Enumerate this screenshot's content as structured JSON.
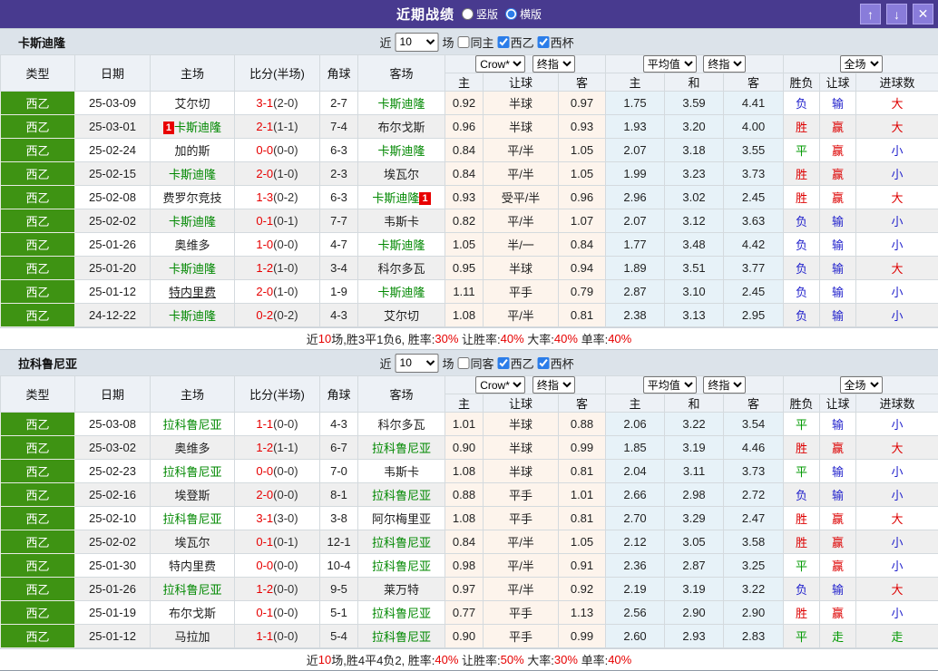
{
  "titlebar": {
    "title": "近期战绩",
    "radios": [
      {
        "label": "竖版",
        "checked": false
      },
      {
        "label": "横版",
        "checked": true
      }
    ],
    "buttons": {
      "up": "↑",
      "down": "↓",
      "close": "✕"
    }
  },
  "colors": {
    "titlebar_purple": "#483a8f",
    "league_green": "#3e9313",
    "win_red": "#dd0000",
    "lose_blue": "#2222cc",
    "draw_green": "#009900",
    "team_green": "#008800",
    "score_red": "#e60000",
    "handicap_col_bg": "#fdf4ec",
    "euro_col_bg": "#e7f2f8"
  },
  "table_headers": {
    "left": [
      "类型",
      "日期",
      "主场",
      "比分(半场)",
      "角球",
      "客场"
    ],
    "groups": [
      {
        "selects": [
          "Crow*",
          "终指"
        ],
        "cols": [
          "主",
          "让球",
          "客"
        ]
      },
      {
        "selects": [
          "平均值",
          "终指"
        ],
        "cols": [
          "主",
          "和",
          "客"
        ]
      },
      {
        "selects": [
          "全场"
        ],
        "cols": [
          "胜负",
          "让球",
          "进球数"
        ]
      }
    ]
  },
  "sections": [
    {
      "team": "卡斯迪隆",
      "filter": {
        "recent_label": "近",
        "count": "10",
        "matches_label": "场",
        "same_label": "同主",
        "same_checked": false,
        "league_label": "西乙",
        "league_checked": true,
        "cup_label": "西杯",
        "cup_checked": true
      },
      "rows": [
        {
          "lg": "西乙",
          "date": "25-03-09",
          "home": {
            "n": "艾尔切"
          },
          "ft": "3-1",
          "ht": "(2-0)",
          "cn": "2-7",
          "away": {
            "n": "卡斯迪隆",
            "g": true
          },
          "ah": [
            "0.92",
            "半球",
            "0.97"
          ],
          "eu": [
            "1.75",
            "3.59",
            "4.41"
          ],
          "res": [
            [
              "负",
              "blue"
            ],
            [
              "输",
              "blue"
            ],
            [
              "大",
              "red"
            ]
          ]
        },
        {
          "lg": "西乙",
          "date": "25-03-01",
          "home": {
            "n": "卡斯迪隆",
            "g": true,
            "b": "1",
            "bp": "l"
          },
          "ft": "2-1",
          "ht": "(1-1)",
          "cn": "7-4",
          "away": {
            "n": "布尔戈斯"
          },
          "ah": [
            "0.96",
            "半球",
            "0.93"
          ],
          "eu": [
            "1.93",
            "3.20",
            "4.00"
          ],
          "res": [
            [
              "胜",
              "red"
            ],
            [
              "赢",
              "red"
            ],
            [
              "大",
              "red"
            ]
          ]
        },
        {
          "lg": "西乙",
          "date": "25-02-24",
          "home": {
            "n": "加的斯"
          },
          "ft": "0-0",
          "ht": "(0-0)",
          "cn": "6-3",
          "away": {
            "n": "卡斯迪隆",
            "g": true
          },
          "ah": [
            "0.84",
            "平/半",
            "1.05"
          ],
          "eu": [
            "2.07",
            "3.18",
            "3.55"
          ],
          "res": [
            [
              "平",
              "green"
            ],
            [
              "赢",
              "red"
            ],
            [
              "小",
              "blue"
            ]
          ]
        },
        {
          "lg": "西乙",
          "date": "25-02-15",
          "home": {
            "n": "卡斯迪隆",
            "g": true
          },
          "ft": "2-0",
          "ht": "(1-0)",
          "cn": "2-3",
          "away": {
            "n": "埃瓦尔"
          },
          "ah": [
            "0.84",
            "平/半",
            "1.05"
          ],
          "eu": [
            "1.99",
            "3.23",
            "3.73"
          ],
          "res": [
            [
              "胜",
              "red"
            ],
            [
              "赢",
              "red"
            ],
            [
              "小",
              "blue"
            ]
          ]
        },
        {
          "lg": "西乙",
          "date": "25-02-08",
          "home": {
            "n": "费罗尔竞技"
          },
          "ft": "1-3",
          "ht": "(0-2)",
          "cn": "6-3",
          "away": {
            "n": "卡斯迪隆",
            "g": true,
            "b": "1",
            "bp": "r"
          },
          "ah": [
            "0.93",
            "受平/半",
            "0.96"
          ],
          "eu": [
            "2.96",
            "3.02",
            "2.45"
          ],
          "res": [
            [
              "胜",
              "red"
            ],
            [
              "赢",
              "red"
            ],
            [
              "大",
              "red"
            ]
          ]
        },
        {
          "lg": "西乙",
          "date": "25-02-02",
          "home": {
            "n": "卡斯迪隆",
            "g": true
          },
          "ft": "0-1",
          "ht": "(0-1)",
          "cn": "7-7",
          "away": {
            "n": "韦斯卡"
          },
          "ah": [
            "0.82",
            "平/半",
            "1.07"
          ],
          "eu": [
            "2.07",
            "3.12",
            "3.63"
          ],
          "res": [
            [
              "负",
              "blue"
            ],
            [
              "输",
              "blue"
            ],
            [
              "小",
              "blue"
            ]
          ]
        },
        {
          "lg": "西乙",
          "date": "25-01-26",
          "home": {
            "n": "奥维多"
          },
          "ft": "1-0",
          "ht": "(0-0)",
          "cn": "4-7",
          "away": {
            "n": "卡斯迪隆",
            "g": true
          },
          "ah": [
            "1.05",
            "半/一",
            "0.84"
          ],
          "eu": [
            "1.77",
            "3.48",
            "4.42"
          ],
          "res": [
            [
              "负",
              "blue"
            ],
            [
              "输",
              "blue"
            ],
            [
              "小",
              "blue"
            ]
          ]
        },
        {
          "lg": "西乙",
          "date": "25-01-20",
          "home": {
            "n": "卡斯迪隆",
            "g": true
          },
          "ft": "1-2",
          "ht": "(1-0)",
          "cn": "3-4",
          "away": {
            "n": "科尔多瓦"
          },
          "ah": [
            "0.95",
            "半球",
            "0.94"
          ],
          "eu": [
            "1.89",
            "3.51",
            "3.77"
          ],
          "res": [
            [
              "负",
              "blue"
            ],
            [
              "输",
              "blue"
            ],
            [
              "大",
              "red"
            ]
          ]
        },
        {
          "lg": "西乙",
          "date": "25-01-12",
          "home": {
            "n": "特内里费",
            "u": true
          },
          "ft": "2-0",
          "ht": "(1-0)",
          "cn": "1-9",
          "away": {
            "n": "卡斯迪隆",
            "g": true
          },
          "ah": [
            "1.11",
            "平手",
            "0.79"
          ],
          "eu": [
            "2.87",
            "3.10",
            "2.45"
          ],
          "res": [
            [
              "负",
              "blue"
            ],
            [
              "输",
              "blue"
            ],
            [
              "小",
              "blue"
            ]
          ]
        },
        {
          "lg": "西乙",
          "date": "24-12-22",
          "home": {
            "n": "卡斯迪隆",
            "g": true
          },
          "ft": "0-2",
          "ht": "(0-2)",
          "cn": "4-3",
          "away": {
            "n": "艾尔切"
          },
          "ah": [
            "1.08",
            "平/半",
            "0.81"
          ],
          "eu": [
            "2.38",
            "3.13",
            "2.95"
          ],
          "res": [
            [
              "负",
              "blue"
            ],
            [
              "输",
              "blue"
            ],
            [
              "小",
              "blue"
            ]
          ]
        }
      ],
      "summary": [
        {
          "t": "近"
        },
        {
          "t": "10",
          "red": true
        },
        {
          "t": "场,胜3平1负6, 胜率:"
        },
        {
          "t": "30%",
          "red": true
        },
        {
          "t": " 让胜率:"
        },
        {
          "t": "40%",
          "red": true
        },
        {
          "t": " 大率:"
        },
        {
          "t": "40%",
          "red": true
        },
        {
          "t": " 单率:"
        },
        {
          "t": "40%",
          "red": true
        }
      ]
    },
    {
      "team": "拉科鲁尼亚",
      "filter": {
        "recent_label": "近",
        "count": "10",
        "matches_label": "场",
        "same_label": "同客",
        "same_checked": false,
        "league_label": "西乙",
        "league_checked": true,
        "cup_label": "西杯",
        "cup_checked": true
      },
      "rows": [
        {
          "lg": "西乙",
          "date": "25-03-08",
          "home": {
            "n": "拉科鲁尼亚",
            "g": true
          },
          "ft": "1-1",
          "ht": "(0-0)",
          "cn": "4-3",
          "away": {
            "n": "科尔多瓦"
          },
          "ah": [
            "1.01",
            "半球",
            "0.88"
          ],
          "eu": [
            "2.06",
            "3.22",
            "3.54"
          ],
          "res": [
            [
              "平",
              "green"
            ],
            [
              "输",
              "blue"
            ],
            [
              "小",
              "blue"
            ]
          ]
        },
        {
          "lg": "西乙",
          "date": "25-03-02",
          "home": {
            "n": "奥维多"
          },
          "ft": "1-2",
          "ht": "(1-1)",
          "cn": "6-7",
          "away": {
            "n": "拉科鲁尼亚",
            "g": true
          },
          "ah": [
            "0.90",
            "半球",
            "0.99"
          ],
          "eu": [
            "1.85",
            "3.19",
            "4.46"
          ],
          "res": [
            [
              "胜",
              "red"
            ],
            [
              "赢",
              "red"
            ],
            [
              "大",
              "red"
            ]
          ]
        },
        {
          "lg": "西乙",
          "date": "25-02-23",
          "home": {
            "n": "拉科鲁尼亚",
            "g": true
          },
          "ft": "0-0",
          "ht": "(0-0)",
          "cn": "7-0",
          "away": {
            "n": "韦斯卡"
          },
          "ah": [
            "1.08",
            "半球",
            "0.81"
          ],
          "eu": [
            "2.04",
            "3.11",
            "3.73"
          ],
          "res": [
            [
              "平",
              "green"
            ],
            [
              "输",
              "blue"
            ],
            [
              "小",
              "blue"
            ]
          ]
        },
        {
          "lg": "西乙",
          "date": "25-02-16",
          "home": {
            "n": "埃登斯"
          },
          "ft": "2-0",
          "ht": "(0-0)",
          "cn": "8-1",
          "away": {
            "n": "拉科鲁尼亚",
            "g": true
          },
          "ah": [
            "0.88",
            "平手",
            "1.01"
          ],
          "eu": [
            "2.66",
            "2.98",
            "2.72"
          ],
          "res": [
            [
              "负",
              "blue"
            ],
            [
              "输",
              "blue"
            ],
            [
              "小",
              "blue"
            ]
          ]
        },
        {
          "lg": "西乙",
          "date": "25-02-10",
          "home": {
            "n": "拉科鲁尼亚",
            "g": true
          },
          "ft": "3-1",
          "ht": "(3-0)",
          "cn": "3-8",
          "away": {
            "n": "阿尔梅里亚"
          },
          "ah": [
            "1.08",
            "平手",
            "0.81"
          ],
          "eu": [
            "2.70",
            "3.29",
            "2.47"
          ],
          "res": [
            [
              "胜",
              "red"
            ],
            [
              "赢",
              "red"
            ],
            [
              "大",
              "red"
            ]
          ]
        },
        {
          "lg": "西乙",
          "date": "25-02-02",
          "home": {
            "n": "埃瓦尔"
          },
          "ft": "0-1",
          "ht": "(0-1)",
          "cn": "12-1",
          "away": {
            "n": "拉科鲁尼亚",
            "g": true
          },
          "ah": [
            "0.84",
            "平/半",
            "1.05"
          ],
          "eu": [
            "2.12",
            "3.05",
            "3.58"
          ],
          "res": [
            [
              "胜",
              "red"
            ],
            [
              "赢",
              "red"
            ],
            [
              "小",
              "blue"
            ]
          ]
        },
        {
          "lg": "西乙",
          "date": "25-01-30",
          "home": {
            "n": "特内里费"
          },
          "ft": "0-0",
          "ht": "(0-0)",
          "cn": "10-4",
          "away": {
            "n": "拉科鲁尼亚",
            "g": true
          },
          "ah": [
            "0.98",
            "平/半",
            "0.91"
          ],
          "eu": [
            "2.36",
            "2.87",
            "3.25"
          ],
          "res": [
            [
              "平",
              "green"
            ],
            [
              "赢",
              "red"
            ],
            [
              "小",
              "blue"
            ]
          ]
        },
        {
          "lg": "西乙",
          "date": "25-01-26",
          "home": {
            "n": "拉科鲁尼亚",
            "g": true
          },
          "ft": "1-2",
          "ht": "(0-0)",
          "cn": "9-5",
          "away": {
            "n": "莱万特"
          },
          "ah": [
            "0.97",
            "平/半",
            "0.92"
          ],
          "eu": [
            "2.19",
            "3.19",
            "3.22"
          ],
          "res": [
            [
              "负",
              "blue"
            ],
            [
              "输",
              "blue"
            ],
            [
              "大",
              "red"
            ]
          ]
        },
        {
          "lg": "西乙",
          "date": "25-01-19",
          "home": {
            "n": "布尔戈斯"
          },
          "ft": "0-1",
          "ht": "(0-0)",
          "cn": "5-1",
          "away": {
            "n": "拉科鲁尼亚",
            "g": true
          },
          "ah": [
            "0.77",
            "平手",
            "1.13"
          ],
          "eu": [
            "2.56",
            "2.90",
            "2.90"
          ],
          "res": [
            [
              "胜",
              "red"
            ],
            [
              "赢",
              "red"
            ],
            [
              "小",
              "blue"
            ]
          ]
        },
        {
          "lg": "西乙",
          "date": "25-01-12",
          "home": {
            "n": "马拉加"
          },
          "ft": "1-1",
          "ht": "(0-0)",
          "cn": "5-4",
          "away": {
            "n": "拉科鲁尼亚",
            "g": true
          },
          "ah": [
            "0.90",
            "平手",
            "0.99"
          ],
          "eu": [
            "2.60",
            "2.93",
            "2.83"
          ],
          "res": [
            [
              "平",
              "green"
            ],
            [
              "走",
              "green"
            ],
            [
              "走",
              "green"
            ]
          ]
        }
      ],
      "summary": [
        {
          "t": "近"
        },
        {
          "t": "10",
          "red": true
        },
        {
          "t": "场,胜4平4负2, 胜率:"
        },
        {
          "t": "40%",
          "red": true
        },
        {
          "t": " 让胜率:"
        },
        {
          "t": "50%",
          "red": true
        },
        {
          "t": " 大率:"
        },
        {
          "t": "30%",
          "red": true
        },
        {
          "t": " 单率:"
        },
        {
          "t": "40%",
          "red": true
        }
      ]
    }
  ]
}
